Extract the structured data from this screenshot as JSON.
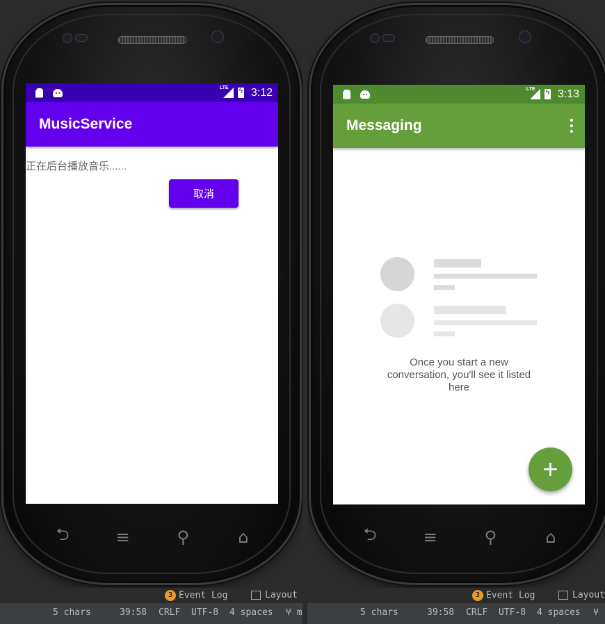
{
  "left_emulator": {
    "status": {
      "time": "3:12",
      "lte": "LTE"
    },
    "app_title": "MusicService",
    "message": "正在后台播放音乐......",
    "cancel_label": "取消",
    "colors": {
      "primary": "#6200ee",
      "primary_dark": "#3700b3"
    }
  },
  "right_emulator": {
    "status": {
      "time": "3:13",
      "lte": "LTE"
    },
    "app_title": "Messaging",
    "empty_lines": [
      "Once you start a new",
      "conversation, you'll see it listed",
      "here"
    ],
    "fab_label": "+",
    "colors": {
      "primary": "#659f3c",
      "primary_dark": "#4e8a2e"
    }
  },
  "nav_keys": {
    "back": "⮌",
    "menu": "≡",
    "search": "⚲",
    "home": "⌂"
  },
  "ide": {
    "event_log_count": "3",
    "event_log_label": "Event Log",
    "layout_label": "Layout",
    "chars": "5 chars",
    "position": "39:58",
    "line_sep": "CRLF",
    "encoding": "UTF-8",
    "indent": "4 spaces",
    "branch_suffix": "m"
  }
}
